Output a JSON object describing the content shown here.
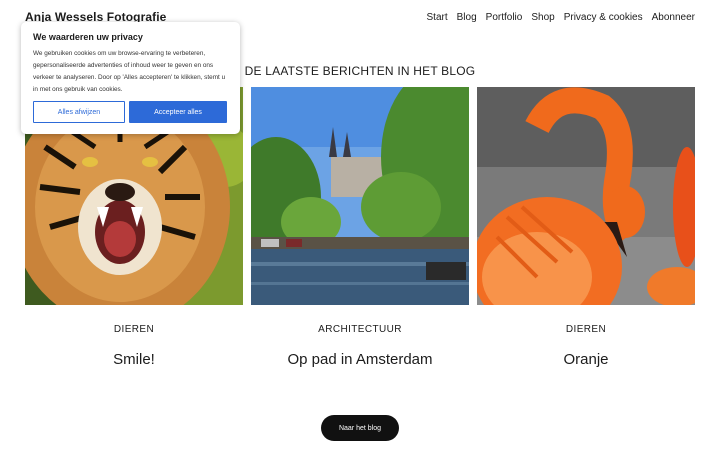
{
  "site": {
    "title": "Anja Wessels Fotografie"
  },
  "nav": {
    "items": [
      "Start",
      "Blog",
      "Portfolio",
      "Shop",
      "Privacy & cookies",
      "Abonneer"
    ]
  },
  "blog": {
    "heading": "DE LAATSTE BERICHTEN IN HET BLOG",
    "posts": [
      {
        "category": "DIEREN",
        "title": "Smile!"
      },
      {
        "category": "ARCHITECTUUR",
        "title": "Op pad in Amsterdam"
      },
      {
        "category": "DIEREN",
        "title": "Oranje"
      }
    ],
    "button_label": "Naar het blog"
  },
  "cookie": {
    "title": "We waarderen uw privacy",
    "text": "We gebruiken cookies om uw browse-ervaring te verbeteren, gepersonaliseerde advertenties of inhoud weer te geven en ons verkeer te analyseren. Door op 'Alles accepteren' te klikken, stemt u in met ons gebruik van cookies.",
    "reject_label": "Alles afwijzen",
    "accept_label": "Accepteer alles"
  },
  "colors": {
    "accent": "#2d6ad8",
    "button_dark": "#111111"
  }
}
